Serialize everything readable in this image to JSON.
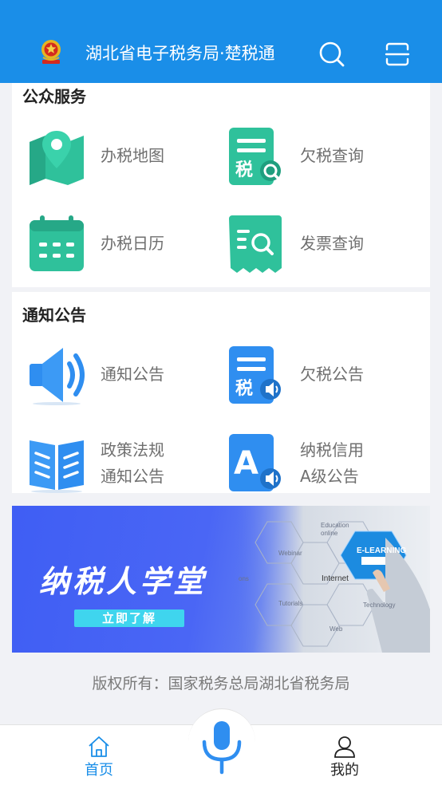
{
  "header": {
    "title": "湖北省电子税务局·楚税通",
    "emblem_text": "国徽",
    "search_icon": "search-icon",
    "scan_icon": "scan-icon",
    "color": "#1a8ee8"
  },
  "public_services": {
    "title": "公众服务",
    "items": [
      {
        "label": "办税地图",
        "icon": "map-pin-icon"
      },
      {
        "label": "欠税查询",
        "icon": "tax-document-search-icon"
      },
      {
        "label": "办税日历",
        "icon": "calendar-icon"
      },
      {
        "label": "发票查询",
        "icon": "invoice-search-icon"
      }
    ],
    "accent": "#31c59f"
  },
  "notices": {
    "title": "通知公告",
    "items": [
      {
        "label": "通知公告",
        "icon": "speaker-icon"
      },
      {
        "label": "欠税公告",
        "icon": "tax-announcement-icon"
      },
      {
        "label_lines": [
          "政策法规",
          "通知公告"
        ],
        "icon": "open-book-icon"
      },
      {
        "label_lines": [
          "纳税信用",
          "A级公告"
        ],
        "icon": "credit-a-announcement-icon"
      }
    ],
    "accent": "#2f8ef0"
  },
  "banner": {
    "title": "纳税人学堂",
    "button": "立即了解",
    "art_words": [
      "Education online",
      "E-LEARNING",
      "Webinar",
      "Internet",
      "Tutorials",
      "Technology",
      "Web",
      "ons"
    ]
  },
  "footer": {
    "copyright": "版权所有：国家税务总局湖北省税务局"
  },
  "tabbar": {
    "home": "首页",
    "mine": "我的",
    "voice_icon": "microphone-icon"
  }
}
